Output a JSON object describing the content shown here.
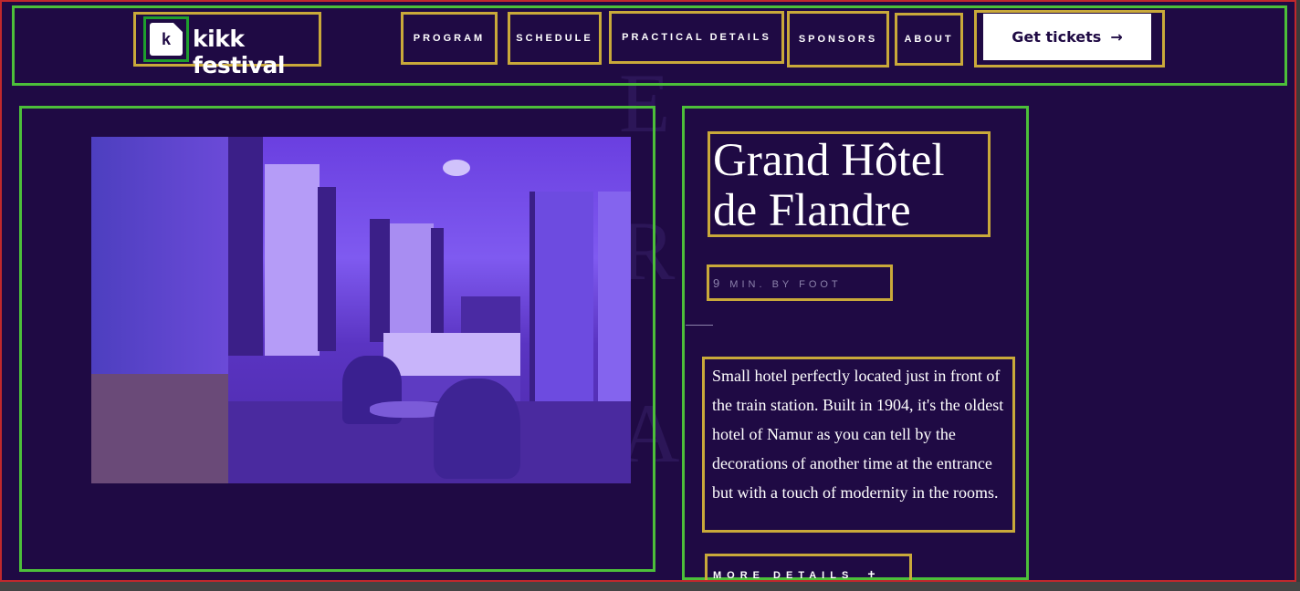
{
  "nav": {
    "logo_text": "kikk festival",
    "logo_glyph": "k",
    "items": [
      {
        "label": "PROGRAM"
      },
      {
        "label": "SCHEDULE"
      },
      {
        "label": "PRACTICAL DETAILS"
      },
      {
        "label": "SPONSORS"
      },
      {
        "label": "ABOUT"
      }
    ],
    "cta_label": "Get tickets",
    "cta_arrow": "→"
  },
  "hotel": {
    "title_line1": "Grand Hôtel",
    "title_line2": "de Flandre",
    "distance_value": "9",
    "distance_unit": "MIN. BY FOOT",
    "description": "Small hotel perfectly located just in front of the train station. Built in 1904, it's the oldest hotel of Namur as you can tell by the decorations of another time at the entrance but with a touch of modernity in the rooms.",
    "more_label": "MORE DETAILS",
    "more_icon": "+"
  },
  "background_letters": [
    "E",
    "R",
    "A"
  ],
  "colors": {
    "background": "#1f0a44",
    "accent_green": "#4cbf3a",
    "accent_gold": "#c9a93a",
    "frame_red": "#c0282d",
    "photo_tint": "#7f5af0"
  },
  "icons": [
    "kikk-logo-icon",
    "arrow-right-icon",
    "plus-icon"
  ]
}
